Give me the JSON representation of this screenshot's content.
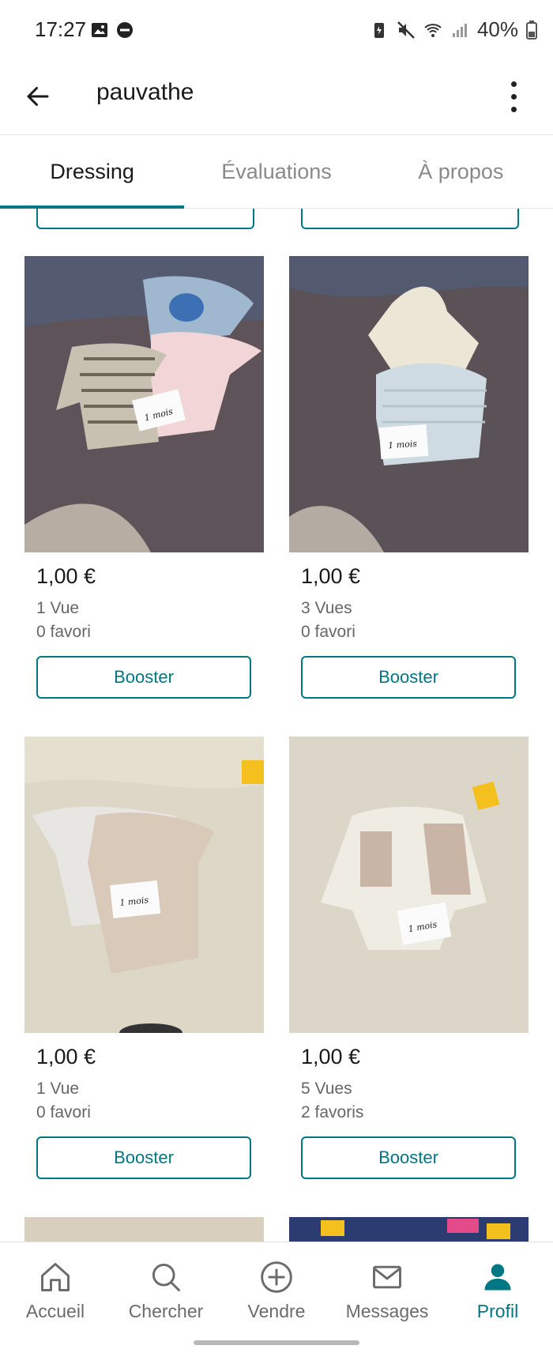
{
  "status_bar": {
    "time": "17:27",
    "battery": "40%"
  },
  "app_bar": {
    "title": "pauvathe"
  },
  "tabs": [
    {
      "label": "Dressing",
      "active": true
    },
    {
      "label": "Évaluations",
      "active": false
    },
    {
      "label": "À propos",
      "active": false
    }
  ],
  "items": [
    {
      "price": "1,00 €",
      "views": "1 Vue",
      "favorites": "0 favori",
      "booster_label": "Booster"
    },
    {
      "price": "1,00 €",
      "views": "3 Vues",
      "favorites": "0 favori",
      "booster_label": "Booster"
    },
    {
      "price": "1,00 €",
      "views": "1 Vue",
      "favorites": "0 favori",
      "booster_label": "Booster"
    },
    {
      "price": "1,00 €",
      "views": "5 Vues",
      "favorites": "2 favoris",
      "booster_label": "Booster"
    }
  ],
  "photo_tags": [
    "1 mois",
    "1 mois",
    "1 mois",
    "1 mois"
  ],
  "bottom_nav": [
    {
      "label": "Accueil",
      "icon": "home-icon",
      "active": false
    },
    {
      "label": "Chercher",
      "icon": "search-icon",
      "active": false
    },
    {
      "label": "Vendre",
      "icon": "plus-circle-icon",
      "active": false
    },
    {
      "label": "Messages",
      "icon": "mail-icon",
      "active": false
    },
    {
      "label": "Profil",
      "icon": "profile-icon",
      "active": true
    }
  ],
  "colors": {
    "accent": "#007782",
    "text": "#1a1a1a",
    "muted": "#666666"
  }
}
